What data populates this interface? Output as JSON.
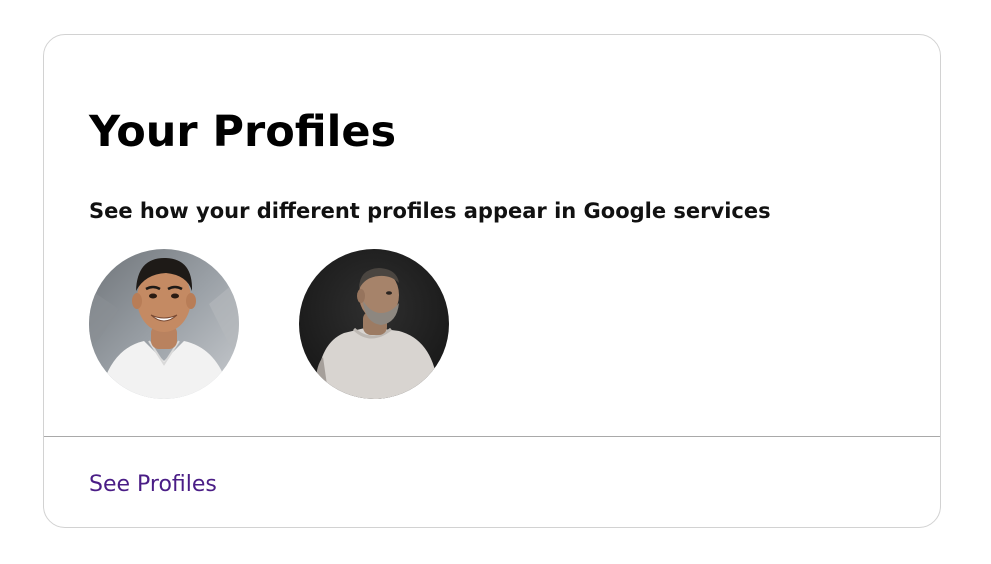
{
  "card": {
    "title": "Your Profiles",
    "subtitle": "See how your different profiles appear in Google services",
    "profiles": [
      {
        "icon": "profile-photo-smiling-man-white-tee"
      },
      {
        "icon": "profile-photo-bearded-man-grey-tee"
      }
    ],
    "footer_link": "See Profiles"
  },
  "colors": {
    "link": "#4a1d86",
    "border": "#d2d2d2",
    "divider": "#a9a9a9"
  }
}
